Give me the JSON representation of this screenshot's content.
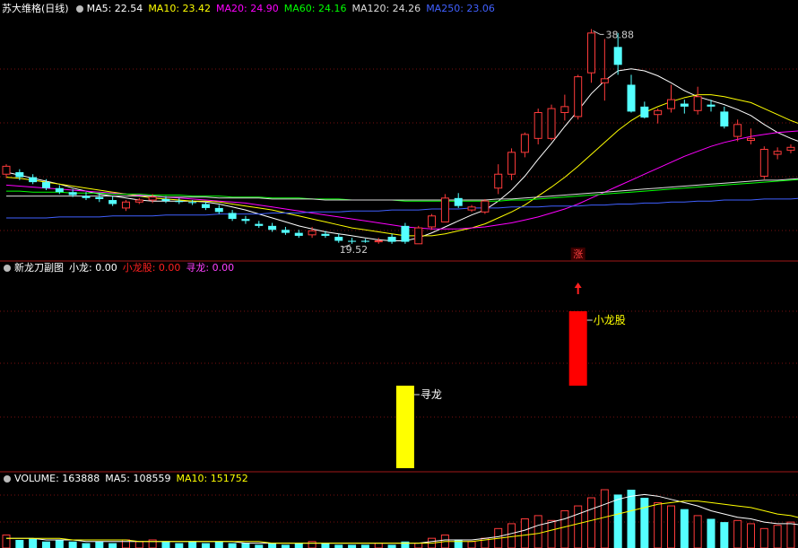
{
  "panels": {
    "price": {
      "title": "苏大维格(日线)",
      "ma": [
        {
          "label": "MA5: 22.54",
          "color": "#ffffff"
        },
        {
          "label": "MA10: 23.42",
          "color": "#ffff00"
        },
        {
          "label": "MA20: 24.90",
          "color": "#ff00ff"
        },
        {
          "label": "MA60: 24.16",
          "color": "#00ff00"
        },
        {
          "label": "MA120: 24.26",
          "color": "#dddddd"
        },
        {
          "label": "MA250: 23.06",
          "color": "#4060ff"
        }
      ]
    },
    "indicator": {
      "title": "新龙刀副图",
      "values": [
        {
          "label": "小龙: 0.00",
          "color": "#ffffff"
        },
        {
          "label": "小龙股: 0.00",
          "color": "#ff2020"
        },
        {
          "label": "寻龙: 0.00",
          "color": "#ff40ff"
        }
      ]
    },
    "volume": {
      "values": [
        {
          "label": "VOLUME: 163888",
          "color": "#ffffff"
        },
        {
          "label": "MA5: 108559",
          "color": "#ffffff"
        },
        {
          "label": "MA10: 151752",
          "color": "#ffff00"
        }
      ]
    }
  },
  "chart_data": {
    "type": "candlestick",
    "high_label": "38.88",
    "low_label": "19.52",
    "up_marker": "涨",
    "signals": [
      {
        "name": "寻龙",
        "index": 30,
        "value": 1.0,
        "color": "#ffff00"
      },
      {
        "name": "小龙股",
        "index": 43,
        "value": 1.0,
        "color": "#ff0000",
        "arrow": true
      }
    ],
    "ohlc": [
      [
        24.6,
        25.6,
        24.2,
        25.4
      ],
      [
        24.8,
        25.1,
        24.0,
        24.3
      ],
      [
        24.3,
        24.6,
        23.6,
        23.8
      ],
      [
        23.8,
        24.1,
        23.0,
        23.2
      ],
      [
        23.2,
        23.5,
        22.6,
        22.8
      ],
      [
        22.8,
        23.1,
        22.3,
        22.5
      ],
      [
        22.4,
        22.8,
        22.0,
        22.2
      ],
      [
        22.3,
        22.7,
        21.8,
        22.1
      ],
      [
        22.0,
        22.4,
        21.4,
        21.6
      ],
      [
        21.2,
        22.0,
        20.9,
        21.8
      ],
      [
        21.8,
        22.2,
        21.6,
        22.0
      ],
      [
        22.0,
        22.6,
        21.7,
        22.3
      ],
      [
        22.1,
        22.4,
        21.7,
        21.9
      ],
      [
        21.9,
        22.2,
        21.6,
        21.8
      ],
      [
        21.8,
        22.0,
        21.5,
        21.7
      ],
      [
        21.6,
        21.8,
        21.0,
        21.2
      ],
      [
        21.2,
        21.5,
        20.6,
        20.8
      ],
      [
        20.7,
        21.0,
        19.9,
        20.1
      ],
      [
        20.1,
        20.4,
        19.6,
        19.9
      ],
      [
        19.6,
        19.9,
        19.2,
        19.4
      ],
      [
        19.4,
        19.7,
        18.8,
        19.0
      ],
      [
        19.0,
        19.3,
        18.5,
        18.7
      ],
      [
        18.7,
        19.0,
        18.2,
        18.4
      ],
      [
        18.5,
        19.3,
        18.2,
        18.9
      ],
      [
        18.6,
        18.9,
        18.2,
        18.4
      ],
      [
        18.3,
        18.6,
        17.7,
        17.9
      ],
      [
        17.9,
        18.2,
        17.6,
        17.8
      ],
      [
        17.9,
        18.1,
        17.7,
        17.8
      ],
      [
        17.8,
        18.2,
        17.6,
        17.9
      ],
      [
        18.3,
        18.6,
        17.6,
        17.8
      ],
      [
        19.4,
        19.7,
        17.6,
        17.8
      ],
      [
        17.6,
        19.4,
        17.6,
        19.2
      ],
      [
        19.3,
        20.6,
        19.0,
        20.4
      ],
      [
        19.8,
        22.6,
        19.8,
        22.2
      ],
      [
        22.2,
        22.7,
        21.2,
        21.4
      ],
      [
        21.0,
        21.5,
        20.8,
        21.3
      ],
      [
        20.8,
        22.1,
        20.6,
        21.9
      ],
      [
        23.2,
        25.6,
        22.6,
        24.6
      ],
      [
        24.6,
        27.2,
        24.0,
        26.8
      ],
      [
        26.8,
        28.8,
        26.3,
        28.6
      ],
      [
        28.2,
        31.2,
        27.6,
        30.8
      ],
      [
        28.2,
        31.6,
        28.0,
        31.2
      ],
      [
        30.8,
        32.6,
        30.0,
        31.4
      ],
      [
        30.4,
        34.6,
        30.1,
        34.4
      ],
      [
        34.8,
        39.2,
        33.8,
        38.8
      ],
      [
        33.8,
        38.2,
        32.0,
        34.2
      ],
      [
        37.4,
        38.8,
        34.6,
        35.6
      ],
      [
        33.6,
        34.6,
        30.8,
        30.9
      ],
      [
        31.4,
        31.9,
        30.2,
        30.3
      ],
      [
        30.6,
        31.2,
        29.7,
        31.0
      ],
      [
        31.2,
        33.6,
        30.8,
        32.1
      ],
      [
        31.7,
        32.1,
        30.7,
        31.4
      ],
      [
        31.0,
        33.4,
        30.6,
        32.4
      ],
      [
        31.6,
        32.1,
        30.9,
        31.4
      ],
      [
        30.9,
        31.4,
        29.2,
        29.4
      ],
      [
        28.4,
        30.1,
        27.9,
        29.6
      ],
      [
        28.0,
        29.2,
        27.6,
        28.2
      ],
      [
        24.4,
        27.4,
        24.1,
        27.1
      ],
      [
        26.6,
        27.3,
        26.1,
        26.9
      ],
      [
        27.0,
        27.6,
        26.7,
        27.3
      ],
      [
        28.0,
        28.3,
        26.6,
        26.9
      ],
      [
        25.6,
        27.5,
        25.4,
        27.2
      ],
      [
        26.8,
        28.9,
        26.4,
        28.6
      ]
    ],
    "ma_series": [
      {
        "name": "MA5",
        "color": "#ffffff",
        "values": [
          24.8,
          24.5,
          24.2,
          23.9,
          23.6,
          23.2,
          22.9,
          22.6,
          22.4,
          22.2,
          22.0,
          21.9,
          21.9,
          21.9,
          21.9,
          21.8,
          21.6,
          21.3,
          21.0,
          20.6,
          20.2,
          19.8,
          19.4,
          19.1,
          18.8,
          18.6,
          18.4,
          18.2,
          18.0,
          17.9,
          17.9,
          18.2,
          18.7,
          19.3,
          19.9,
          20.5,
          21.0,
          21.9,
          23.0,
          24.4,
          26.1,
          27.7,
          29.4,
          31.0,
          32.7,
          34.0,
          35.0,
          35.2,
          35.0,
          34.5,
          33.8,
          33.0,
          32.4,
          32.0,
          31.6,
          31.1,
          30.5,
          29.6,
          28.8,
          28.2,
          27.7,
          27.4,
          27.3
        ]
      },
      {
        "name": "MA10",
        "color": "#ffff00",
        "values": [
          24.3,
          24.2,
          24.0,
          23.8,
          23.6,
          23.4,
          23.2,
          23.0,
          22.8,
          22.6,
          22.4,
          22.2,
          22.1,
          22.0,
          21.9,
          21.9,
          21.8,
          21.6,
          21.4,
          21.2,
          21.0,
          20.7,
          20.4,
          20.1,
          19.8,
          19.5,
          19.2,
          19.0,
          18.8,
          18.6,
          18.4,
          18.4,
          18.4,
          18.6,
          18.9,
          19.2,
          19.6,
          20.2,
          20.8,
          21.5,
          22.4,
          23.3,
          24.3,
          25.4,
          26.6,
          27.8,
          29.0,
          30.0,
          30.8,
          31.4,
          31.9,
          32.3,
          32.6,
          32.6,
          32.4,
          32.1,
          31.8,
          31.2,
          30.6,
          30.0,
          29.5,
          29.0,
          28.6
        ]
      },
      {
        "name": "MA20",
        "color": "#ff00ff",
        "values": [
          23.5,
          23.4,
          23.3,
          23.2,
          23.1,
          23.0,
          22.9,
          22.8,
          22.7,
          22.6,
          22.5,
          22.4,
          22.3,
          22.2,
          22.1,
          22.0,
          21.9,
          21.8,
          21.7,
          21.5,
          21.3,
          21.1,
          20.9,
          20.7,
          20.5,
          20.3,
          20.1,
          19.9,
          19.7,
          19.5,
          19.3,
          19.2,
          19.1,
          19.1,
          19.1,
          19.2,
          19.3,
          19.5,
          19.7,
          20.0,
          20.3,
          20.7,
          21.1,
          21.6,
          22.2,
          22.8,
          23.4,
          24.0,
          24.6,
          25.2,
          25.8,
          26.4,
          26.9,
          27.4,
          27.8,
          28.1,
          28.4,
          28.6,
          28.8,
          28.9,
          29.0,
          29.0,
          29.0
        ]
      },
      {
        "name": "MA60",
        "color": "#00ff00",
        "values": [
          22.9,
          22.9,
          22.8,
          22.8,
          22.8,
          22.7,
          22.7,
          22.7,
          22.6,
          22.6,
          22.6,
          22.5,
          22.5,
          22.5,
          22.4,
          22.4,
          22.4,
          22.3,
          22.3,
          22.3,
          22.2,
          22.2,
          22.2,
          22.1,
          22.1,
          22.1,
          22.0,
          22.0,
          22.0,
          22.0,
          21.9,
          21.9,
          21.9,
          21.9,
          21.9,
          21.9,
          21.9,
          21.9,
          22.0,
          22.0,
          22.1,
          22.2,
          22.3,
          22.4,
          22.5,
          22.6,
          22.7,
          22.8,
          22.9,
          23.0,
          23.1,
          23.2,
          23.3,
          23.4,
          23.5,
          23.6,
          23.7,
          23.8,
          23.9,
          24.0,
          24.1,
          24.1,
          24.2
        ]
      },
      {
        "name": "MA120",
        "color": "#dddddd",
        "values": [
          22.4,
          22.4,
          22.4,
          22.4,
          22.4,
          22.4,
          22.4,
          22.4,
          22.4,
          22.4,
          22.4,
          22.4,
          22.3,
          22.3,
          22.3,
          22.3,
          22.2,
          22.2,
          22.2,
          22.2,
          22.1,
          22.1,
          22.1,
          22.1,
          22.0,
          22.0,
          22.0,
          22.0,
          22.0,
          22.0,
          22.0,
          22.0,
          22.0,
          22.0,
          22.0,
          22.0,
          22.0,
          22.1,
          22.1,
          22.2,
          22.3,
          22.4,
          22.5,
          22.6,
          22.7,
          22.8,
          22.9,
          23.0,
          23.1,
          23.2,
          23.3,
          23.4,
          23.5,
          23.6,
          23.7,
          23.8,
          23.9,
          24.0,
          24.0,
          24.1,
          24.2,
          24.2,
          24.3
        ]
      },
      {
        "name": "MA250",
        "color": "#4060ff",
        "values": [
          20.2,
          20.2,
          20.2,
          20.2,
          20.3,
          20.3,
          20.3,
          20.3,
          20.4,
          20.4,
          20.4,
          20.4,
          20.5,
          20.5,
          20.5,
          20.5,
          20.6,
          20.6,
          20.6,
          20.6,
          20.7,
          20.7,
          20.7,
          20.8,
          20.8,
          20.8,
          20.9,
          20.9,
          20.9,
          21.0,
          21.0,
          21.0,
          21.1,
          21.1,
          21.1,
          21.2,
          21.2,
          21.2,
          21.3,
          21.3,
          21.3,
          21.4,
          21.4,
          21.4,
          21.5,
          21.5,
          21.6,
          21.6,
          21.7,
          21.7,
          21.8,
          21.8,
          21.9,
          21.9,
          22.0,
          22.0,
          22.0,
          22.1,
          22.1,
          22.1,
          22.2,
          22.2,
          22.3
        ]
      }
    ],
    "volume": [
      8,
      5,
      6,
      4,
      5,
      4,
      3,
      4,
      3,
      5,
      4,
      5,
      4,
      3,
      4,
      3,
      4,
      3,
      3,
      2,
      3,
      2,
      3,
      4,
      3,
      2,
      2,
      2,
      3,
      2,
      4,
      3,
      6,
      8,
      5,
      4,
      6,
      12,
      15,
      18,
      20,
      17,
      23,
      26,
      31,
      36,
      33,
      36,
      31,
      28,
      26,
      24,
      20,
      18,
      16,
      17,
      15,
      12,
      14,
      16,
      13,
      14,
      12
    ],
    "volume_ma": [
      {
        "name": "MA5",
        "color": "#ffffff",
        "values": [
          6,
          6,
          6,
          5,
          5,
          5,
          4,
          4,
          4,
          4,
          4,
          4,
          4,
          4,
          4,
          4,
          4,
          4,
          3,
          3,
          3,
          3,
          3,
          3,
          3,
          3,
          3,
          3,
          3,
          3,
          3,
          3,
          4,
          5,
          5,
          5,
          6,
          7,
          9,
          11,
          14,
          16,
          18,
          21,
          24,
          27,
          30,
          32,
          33,
          32,
          30,
          28,
          26,
          23,
          21,
          19,
          18,
          16,
          15,
          15,
          14,
          14,
          14
        ]
      },
      {
        "name": "MA10",
        "color": "#ffff00",
        "values": [
          6,
          6,
          6,
          6,
          6,
          5,
          5,
          5,
          5,
          5,
          4,
          4,
          4,
          4,
          4,
          4,
          4,
          4,
          4,
          4,
          3,
          3,
          3,
          3,
          3,
          3,
          3,
          3,
          3,
          3,
          3,
          3,
          3,
          4,
          4,
          4,
          5,
          6,
          7,
          8,
          9,
          11,
          13,
          15,
          17,
          19,
          21,
          23,
          25,
          27,
          28,
          29,
          29,
          28,
          27,
          26,
          25,
          23,
          21,
          20,
          18,
          17,
          16
        ]
      }
    ]
  }
}
